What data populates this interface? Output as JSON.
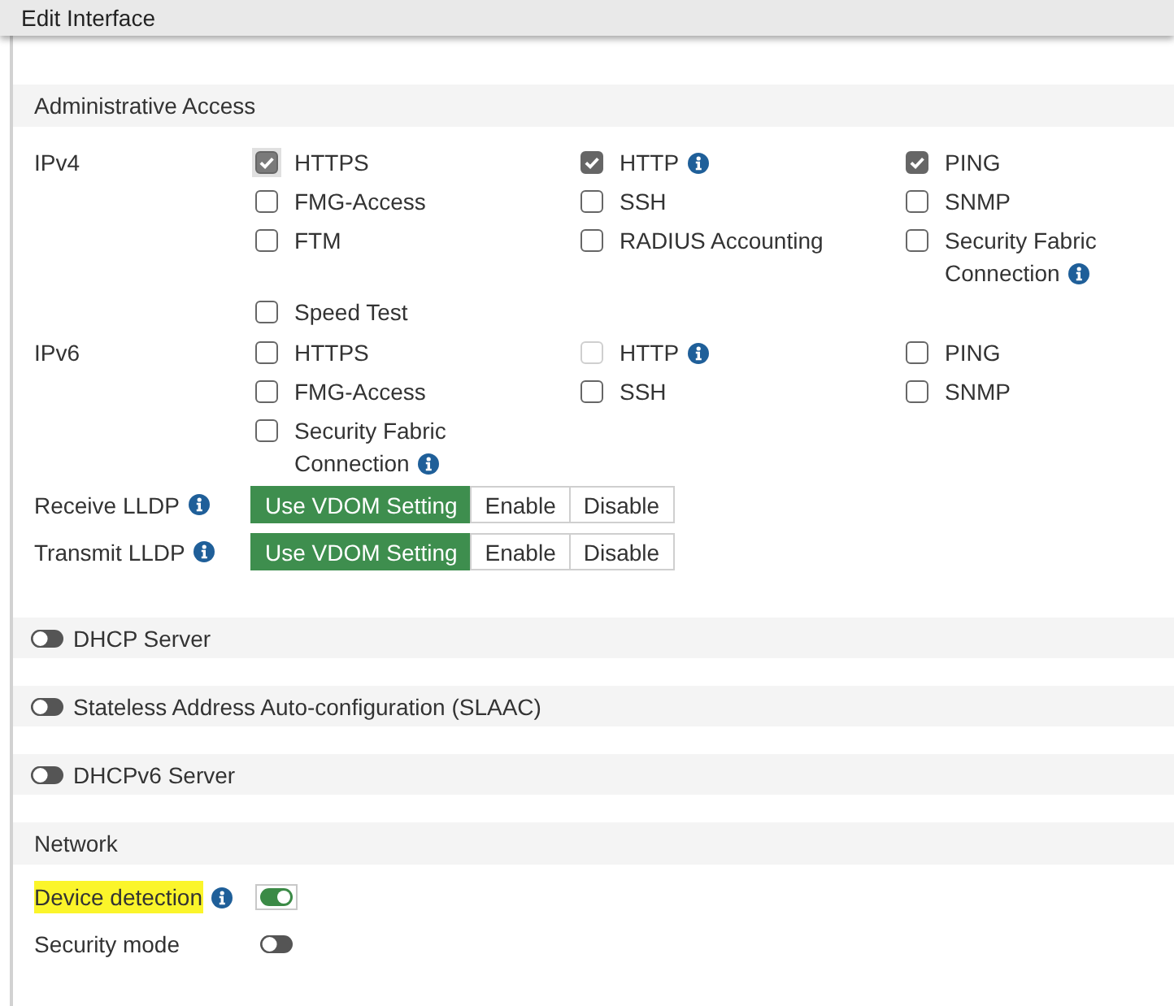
{
  "window": {
    "title": "Edit Interface"
  },
  "admin_access": {
    "title": "Administrative Access",
    "groups": [
      {
        "label": "IPv4",
        "options": [
          {
            "label": "HTTPS",
            "checked": true,
            "disabled": true,
            "info": false
          },
          {
            "label": "HTTP",
            "checked": true,
            "disabled": false,
            "info": true
          },
          {
            "label": "PING",
            "checked": true,
            "disabled": false,
            "info": false
          },
          {
            "label": "FMG-Access",
            "checked": false,
            "disabled": false,
            "info": false
          },
          {
            "label": "SSH",
            "checked": false,
            "disabled": false,
            "info": false
          },
          {
            "label": "SNMP",
            "checked": false,
            "disabled": false,
            "info": false
          },
          {
            "label": "FTM",
            "checked": false,
            "disabled": false,
            "info": false
          },
          {
            "label": "RADIUS Accounting",
            "checked": false,
            "disabled": false,
            "info": false
          },
          {
            "label": "Security Fabric Connection",
            "checked": false,
            "disabled": false,
            "info": true
          },
          {
            "label": "Speed Test",
            "checked": false,
            "disabled": false,
            "info": false
          }
        ]
      },
      {
        "label": "IPv6",
        "options": [
          {
            "label": "HTTPS",
            "checked": false,
            "disabled": false,
            "info": false
          },
          {
            "label": "HTTP",
            "checked": false,
            "disabled": true,
            "info": true
          },
          {
            "label": "PING",
            "checked": false,
            "disabled": false,
            "info": false
          },
          {
            "label": "FMG-Access",
            "checked": false,
            "disabled": false,
            "info": false
          },
          {
            "label": "SSH",
            "checked": false,
            "disabled": false,
            "info": false
          },
          {
            "label": "SNMP",
            "checked": false,
            "disabled": false,
            "info": false
          },
          {
            "label": "Security Fabric Connection",
            "checked": false,
            "disabled": false,
            "info": true
          }
        ]
      }
    ],
    "lldp": [
      {
        "label": "Receive LLDP",
        "info": true,
        "options": [
          {
            "label": "Use VDOM Setting",
            "selected": true
          },
          {
            "label": "Enable",
            "selected": false
          },
          {
            "label": "Disable",
            "selected": false
          }
        ]
      },
      {
        "label": "Transmit LLDP",
        "info": true,
        "options": [
          {
            "label": "Use VDOM Setting",
            "selected": true
          },
          {
            "label": "Enable",
            "selected": false
          },
          {
            "label": "Disable",
            "selected": false
          }
        ]
      }
    ]
  },
  "toggle_sections": [
    {
      "title": "DHCP Server",
      "on": false
    },
    {
      "title": "Stateless Address Auto-configuration (SLAAC)",
      "on": false
    },
    {
      "title": "DHCPv6 Server",
      "on": false
    }
  ],
  "network": {
    "title": "Network",
    "fields": [
      {
        "label": "Device detection",
        "info": true,
        "highlighted": true,
        "on": true,
        "focused": true
      },
      {
        "label": "Security mode",
        "info": false,
        "highlighted": false,
        "on": false,
        "focused": false
      }
    ]
  }
}
